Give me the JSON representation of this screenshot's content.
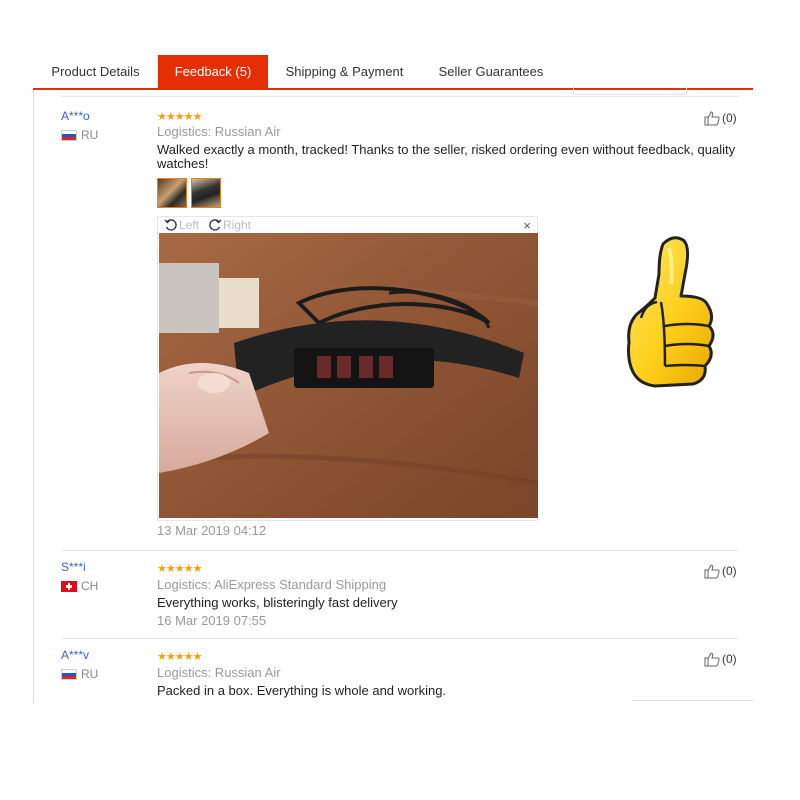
{
  "tabs": [
    {
      "label": "Product Details",
      "active": false
    },
    {
      "label": "Feedback (5)",
      "active": true
    },
    {
      "label": "Shipping & Payment",
      "active": false
    },
    {
      "label": "Seller Guarantees",
      "active": false
    }
  ],
  "colors": {
    "accent": "#e62e04",
    "star": "#f7a10a",
    "link": "#3366cc",
    "muted": "#999999"
  },
  "viewer": {
    "rotate_left": "Left",
    "rotate_right": "Right",
    "close": "×"
  },
  "reviews": [
    {
      "user": "A***o",
      "country": "RU",
      "flag": "flag-ru",
      "stars": "★★★★★",
      "rating": 5,
      "logistics": "Logistics: Russian Air",
      "text": "Walked exactly a month, tracked! Thanks to the seller, risked ordering even without feedback, quality watches!",
      "date": "13 Mar 2019 04:12",
      "helpful": "(0)"
    },
    {
      "user": "S***i",
      "country": "CH",
      "flag": "flag-ch",
      "stars": "★★★★★",
      "rating": 5,
      "logistics": "Logistics: AliExpress Standard Shipping",
      "text": "Everything works, blisteringly fast delivery",
      "date": "16 Mar 2019 07:55",
      "helpful": "(0)"
    },
    {
      "user": "A***v",
      "country": "RU",
      "flag": "flag-ru",
      "stars": "★★★★★",
      "rating": 5,
      "logistics": "Logistics: Russian Air",
      "text": "Packed in a box. Everything is whole and working.",
      "date": "",
      "helpful": "(0)"
    }
  ],
  "decoration": {
    "thumbs_up_sticker": "thumbs-up-icon"
  }
}
